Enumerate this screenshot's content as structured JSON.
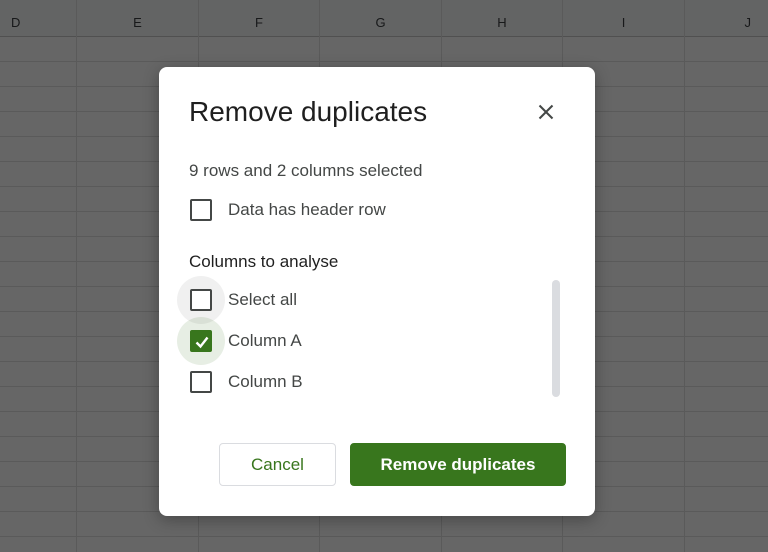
{
  "spreadsheet": {
    "columns": [
      "D",
      "E",
      "F",
      "G",
      "H",
      "I",
      "J"
    ]
  },
  "dialog": {
    "title": "Remove duplicates",
    "close_icon": "close-icon",
    "selection_summary": "9 rows and 2 columns selected",
    "header_row": {
      "label": "Data has header row",
      "checked": false
    },
    "columns_heading": "Columns to analyse",
    "options": [
      {
        "label": "Select all",
        "checked": false
      },
      {
        "label": "Column A",
        "checked": true
      },
      {
        "label": "Column B",
        "checked": false
      }
    ],
    "cancel_label": "Cancel",
    "confirm_label": "Remove duplicates"
  },
  "colors": {
    "accent": "#38761d",
    "overlay": "rgba(0,0,0,0.6)"
  }
}
